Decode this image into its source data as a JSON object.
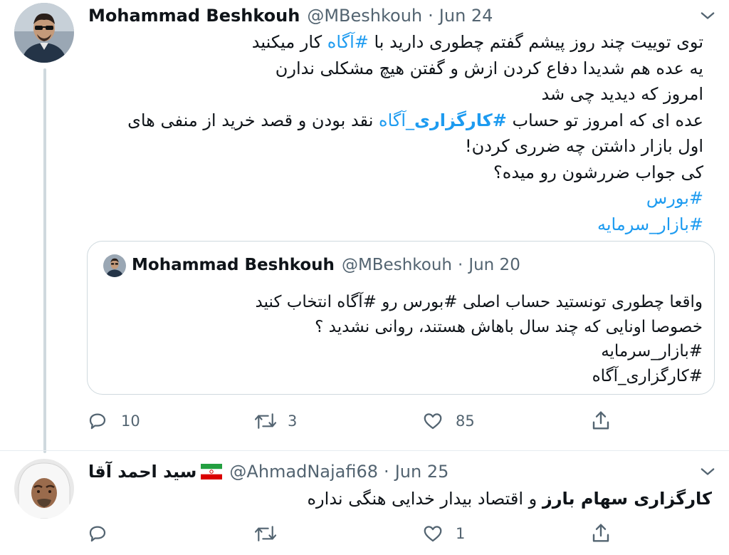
{
  "tweet": {
    "display_name": "Mohammad Beshkouh",
    "handle": "@MBeshkouh",
    "separator": "·",
    "date": "Jun 24",
    "lines": [
      [
        {
          "t": "توی توییت چند روز پیشم گفتم چطوری دارید با "
        },
        {
          "h": "#آگاه"
        },
        {
          "t": " کار میکنید"
        }
      ],
      [
        {
          "t": "یه عده هم شدیدا دفاع کردن ازش و گفتن هیچ مشکلی ندارن"
        }
      ],
      [
        {
          "t": "امروز که دیدید چی شد"
        }
      ],
      [
        {
          "t": "عده ای که امروز تو حساب "
        },
        {
          "hb": "#کارگزاری"
        },
        {
          "h": "_آگاه"
        },
        {
          "t": " نقد بودن و قصد خرید از منفی های"
        }
      ],
      [
        {
          "t": "اول بازار داشتن چه ضرری کردن!"
        }
      ],
      [
        {
          "t": "کی جواب ضررشون رو میده؟"
        }
      ],
      [
        {
          "h": "#بورس"
        }
      ],
      [
        {
          "h": "#بازار_سرمایه"
        }
      ]
    ],
    "quoted": {
      "display_name": "Mohammad Beshkouh",
      "handle": "@MBeshkouh",
      "separator": "·",
      "date": "Jun 20",
      "lines": [
        "واقعا چطوری تونستید حساب اصلی #بورس رو #آگاه انتخاب کنید",
        "خصوصا اونایی که چند سال باهاش هستند، روانی نشدید ؟",
        "#بازار_سرمایه",
        "#کارگزاری_آگاه"
      ]
    },
    "actions": {
      "reply_count": "10",
      "retweet_count": "3",
      "like_count": "85"
    }
  },
  "reply": {
    "display_name": "سید احمد آقا",
    "handle": "@AhmadNajafi68",
    "separator": "·",
    "date": "Jun 25",
    "bold_text": "کارگزاری سهام بارز",
    "text": " و اقتصاد بیدار خدایی هنگی نداره",
    "actions": {
      "like_count": "1"
    }
  },
  "colors": {
    "accent": "#1d9bf0",
    "muted": "#536471",
    "border": "#cfd9de"
  }
}
